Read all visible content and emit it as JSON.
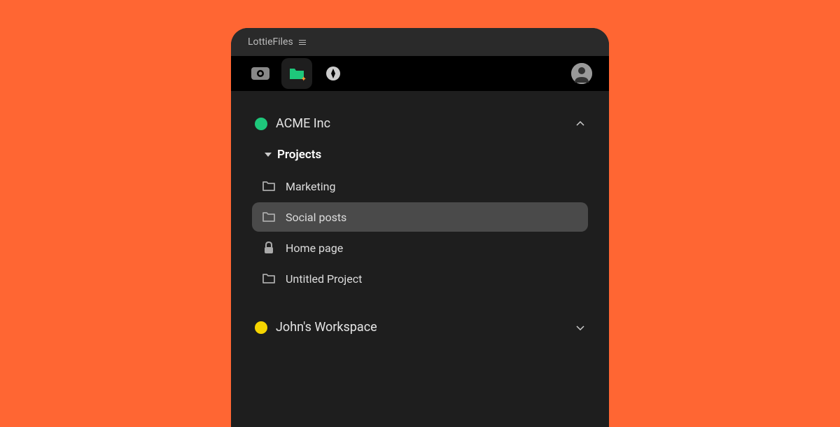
{
  "titlebar": {
    "app_name": "LottieFiles"
  },
  "toolbar": {
    "items": [
      "eye",
      "folder",
      "compass"
    ],
    "active_index": 1
  },
  "workspaces": [
    {
      "name": "ACME Inc",
      "color": "#1ec77b",
      "expanded": true,
      "section_label": "Projects",
      "folders": [
        {
          "name": "Marketing",
          "icon": "folder",
          "selected": false
        },
        {
          "name": "Social posts",
          "icon": "folder",
          "selected": true
        },
        {
          "name": "Home page",
          "icon": "lock",
          "selected": false
        },
        {
          "name": "Untitled Project",
          "icon": "folder",
          "selected": false
        }
      ]
    },
    {
      "name": "John's Workspace",
      "color": "#f5d400",
      "expanded": false
    }
  ],
  "colors": {
    "background": "#ff6633",
    "panel": "#1e1e1e",
    "toolbar": "#000000",
    "selected": "#4a4a4a",
    "accent_folder": "#1ec77b"
  }
}
